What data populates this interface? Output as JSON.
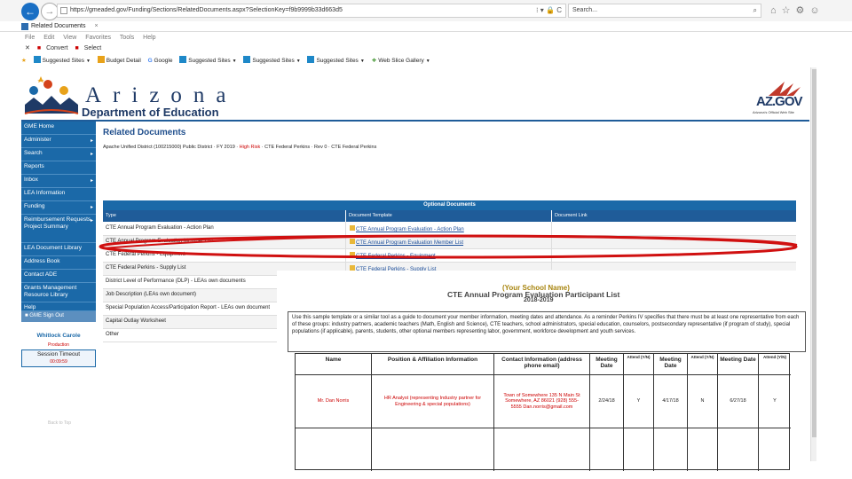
{
  "browser": {
    "url": "https://gmeaded.gov/Funding/Sections/RelatedDocuments.aspx?SelectionKey=f9b9999b33d663d5",
    "url_controls": "⁝ ▾ 🔒 C",
    "search_placeholder": "Search...",
    "search_icon": "⌕",
    "tab_title": "Related Documents",
    "menu": [
      "File",
      "Edit",
      "View",
      "Favorites",
      "Tools",
      "Help"
    ],
    "commands": [
      "Convert",
      "Select"
    ],
    "favorites": [
      {
        "label": "Suggested Sites"
      },
      {
        "label": "Budget Detail"
      },
      {
        "label": "Google"
      },
      {
        "label": "Suggested Sites"
      },
      {
        "label": "Suggested Sites"
      },
      {
        "label": "Suggested Sites"
      },
      {
        "label": "Web Slice Gallery"
      }
    ],
    "icons": [
      "home-icon",
      "star-icon",
      "gear-icon",
      "smiley-icon"
    ]
  },
  "header": {
    "brand": "Arizona",
    "department": "Department of Education",
    "azgov": "AZ.GOV",
    "azgov_sub": "Arizona's Official Web Site"
  },
  "sidebar": {
    "items": [
      {
        "label": "GME Home",
        "arrow": ""
      },
      {
        "label": "Administer",
        "arrow": "▸"
      },
      {
        "label": "Search",
        "arrow": "▸"
      },
      {
        "label": "Reports",
        "arrow": ""
      },
      {
        "label": "Inbox",
        "arrow": "▸"
      },
      {
        "label": "LEA Information",
        "arrow": ""
      },
      {
        "label": "Funding",
        "arrow": "▸"
      },
      {
        "label": "Reimbursement Requests Project Summary",
        "arrow": "▸"
      },
      {
        "label": "LEA Document Library",
        "arrow": ""
      },
      {
        "label": "Address Book",
        "arrow": ""
      },
      {
        "label": "Contact ADE",
        "arrow": ""
      },
      {
        "label": "Grants Management Resource Library",
        "arrow": ""
      },
      {
        "label": "Help",
        "arrow": ""
      }
    ],
    "signout": "GME Sign Out",
    "user": "Whitlock Carole",
    "environment": "Production",
    "timeout_label": "Session Timeout",
    "timeout_value": "00:09:59"
  },
  "content": {
    "title": "Related Documents",
    "subtitle_main": "Apache Unified District (100215000) Public District · FY 2019 ·",
    "subtitle_red": "High Risk",
    "subtitle_rest": "· CTE Federal Perkins · Rev 0 · CTE Federal Perkins",
    "table_caption": "Optional Documents",
    "columns": [
      "Type",
      "Document Template",
      "Document Link"
    ],
    "rows": [
      {
        "type": "CTE Annual Program Evaluation - Action Plan",
        "template": "CTE Annual Program Evaluation - Action Plan"
      },
      {
        "type": "CTE Annual Program Evaluation Member List",
        "template": "CTE Annual Program Evaluation Member List"
      },
      {
        "type": "CTE Federal Perkins - Equipment",
        "template": "CTE Federal Perkins - Equipment"
      },
      {
        "type": "CTE Federal Perkins - Supply List",
        "template": "CTE Federal Perkins - Supply List"
      },
      {
        "type": "District Level of Performance (DLP) - LEAs own documents",
        "template": ""
      },
      {
        "type": "Job Description (LEAs own document)",
        "template": ""
      },
      {
        "type": "Special Population Access/Participation Report - LEAs own document",
        "template": ""
      },
      {
        "type": "Capital Outlay Worksheet",
        "template": ""
      },
      {
        "type": "Other",
        "template": ""
      }
    ],
    "footer_faded": "Back to Top"
  },
  "document": {
    "school": "(Your School Name)",
    "title": "CTE Annual Program Evaluation Participant List",
    "year": "2018-2019",
    "intro": "Use this sample template or a similar tool as a guide to document your member information, meeting dates and attendance. As a reminder Perkins IV specifies that there must be at least one representative from each of these groups: industry partners, academic teachers (Math, English and Science), CTE teachers, school administrators, special education, counselors, postsecondary representative (if program of study), special populations (if applicable), parents, students, other optional members representing labor, government, workforce development and youth services.",
    "headers": [
      "Name",
      "Position & Affiliation Information",
      "Contact Information (address phone email)",
      "Meeting Date",
      "Attend (Y/N)",
      "Meeting Date",
      "Attend (Y/N)",
      "Meeting Date",
      "Attend (Y/N)"
    ],
    "row": {
      "name": "Mr. Dan Norris",
      "position": "HR Analyst (representing Industry partner for Engineering & special populations)",
      "contact": "Town of Somewhere 135 N Main St Somewhere, AZ 86021 (928) 555-5555 Dan.norris@gmail.com",
      "date1": "2/24/18",
      "att1": "Y",
      "date2": "4/17/18",
      "att2": "N",
      "date3": "6/27/18",
      "att3": "Y"
    }
  }
}
